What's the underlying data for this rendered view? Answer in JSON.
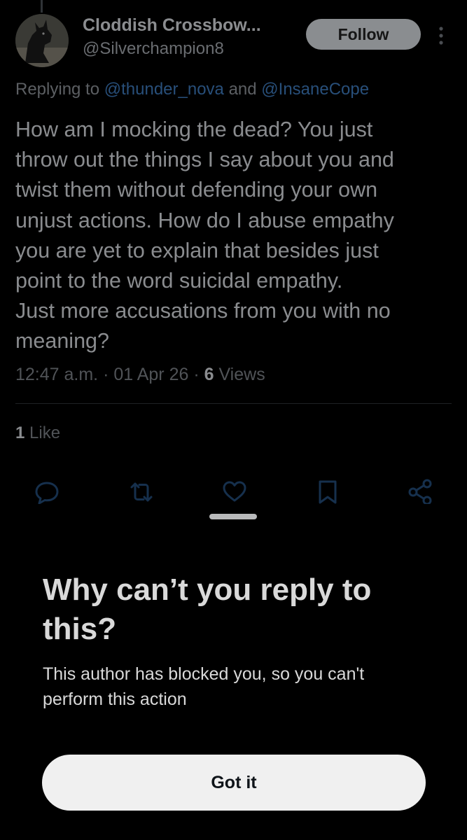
{
  "author": {
    "display_name": "Cloddish Crossbow...",
    "handle": "@Silverchampion8",
    "avatar_icon": "dog-avatar"
  },
  "follow_label": "Follow",
  "more_icon": "more-vertical-icon",
  "replying": {
    "prefix": "Replying to ",
    "mention_1": "@thunder_nova",
    "joiner": " and ",
    "mention_2": "@InsaneCope"
  },
  "tweet_text": "How am I mocking the dead? You just\nthrow out the things I say about you and\ntwist them without defending your own\nunjust actions. How do I abuse empathy\nyou are yet to explain that besides just\npoint to the word suicidal empathy.\nJust more accusations from you with no\nmeaning?",
  "meta": {
    "time": "12:47 a.m.",
    "sep1": " · ",
    "date": "01 Apr 26",
    "sep2": " · ",
    "views_count": "6",
    "views_label": " Views"
  },
  "likes": {
    "count": "1",
    "label": " Like"
  },
  "actions": [
    "reply-icon",
    "retweet-icon",
    "like-icon",
    "bookmark-icon",
    "share-icon"
  ],
  "sheet": {
    "title": "Why can’t you reply to\nthis?",
    "body": "This author has blocked you, so you can't\nperform this action",
    "button_label": "Got it"
  },
  "colors": {
    "background": "#000000",
    "mention_link": "#284f7a",
    "button_bg": "#f0f0f0"
  }
}
